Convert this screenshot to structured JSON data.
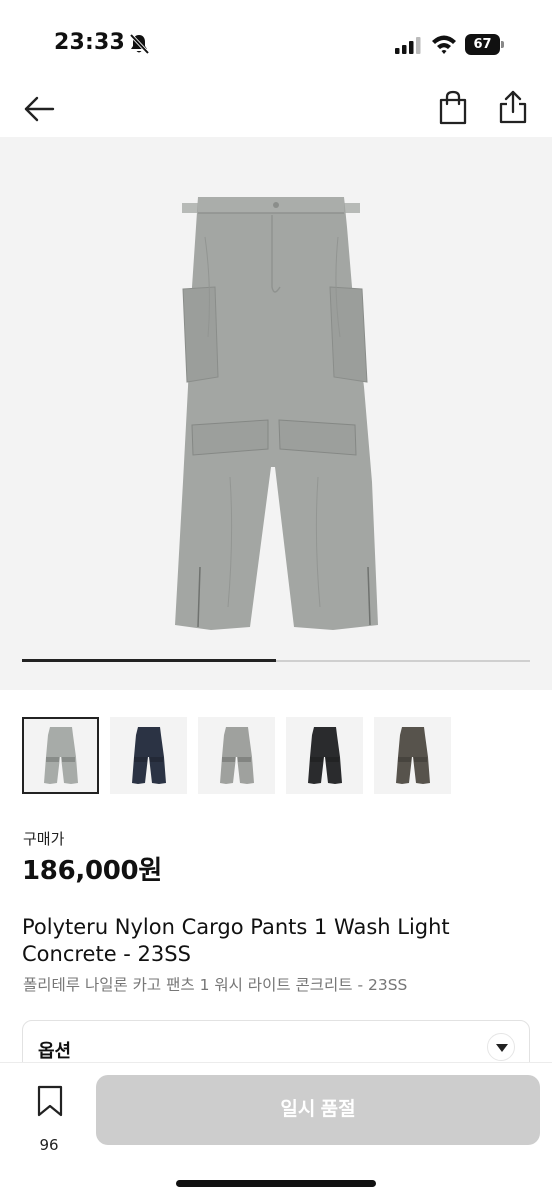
{
  "status_bar": {
    "time": "23:33",
    "battery": "67"
  },
  "product": {
    "price_label": "구매가",
    "price": "186,000원",
    "title": "Polyteru Nylon Cargo Pants 1 Wash Light Concrete - 23SS",
    "subtitle": "폴리테루 나일론 카고 팬츠 1 워시 라이트 콘크리트 - 23SS",
    "image_position": 1,
    "image_count": 2
  },
  "thumbnails": [
    {
      "color": "#a7aba8",
      "selected": true
    },
    {
      "color": "#2b3344",
      "selected": false
    },
    {
      "color": "#9fa19e",
      "selected": false
    },
    {
      "color": "#2a2b2d",
      "selected": false
    },
    {
      "color": "#57534c",
      "selected": false
    }
  ],
  "option": {
    "label": "옵션"
  },
  "bottom_bar": {
    "wish_count": "96",
    "button_label": "일시 품절"
  }
}
